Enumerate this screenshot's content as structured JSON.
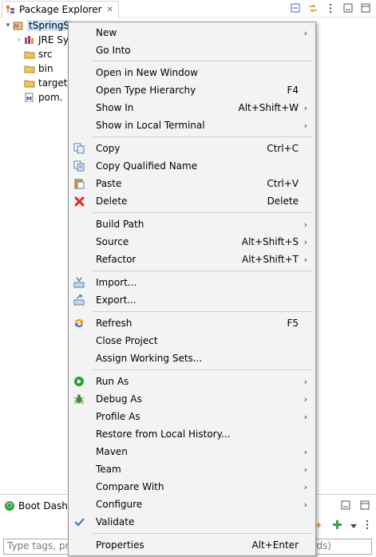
{
  "view": {
    "title": "Package Explorer",
    "close_glyph": "✕"
  },
  "tree": [
    {
      "label": "tSpringS",
      "expanded": true,
      "icon": "maven-project-icon"
    },
    {
      "label": "JRE Sy",
      "expanded": false,
      "icon": "library-icon"
    },
    {
      "label": "src",
      "icon": "folder-icon"
    },
    {
      "label": "bin",
      "icon": "folder-icon"
    },
    {
      "label": "target",
      "icon": "folder-icon"
    },
    {
      "label": "pom.",
      "icon": "maven-file-icon"
    }
  ],
  "menu": {
    "items": [
      {
        "label": "New",
        "accel": "",
        "submenu": true,
        "icon": ""
      },
      {
        "label": "Go Into",
        "accel": "",
        "submenu": false,
        "icon": ""
      },
      {
        "label": "Open in New Window",
        "accel": "",
        "submenu": false,
        "icon": ""
      },
      {
        "label": "Open Type Hierarchy",
        "accel": "F4",
        "submenu": false,
        "icon": ""
      },
      {
        "label": "Show In",
        "accel": "Alt+Shift+W",
        "submenu": true,
        "icon": ""
      },
      {
        "label": "Show in Local Terminal",
        "accel": "",
        "submenu": true,
        "icon": ""
      },
      {
        "label": "Copy",
        "accel": "Ctrl+C",
        "submenu": false,
        "icon": "copy-icon"
      },
      {
        "label": "Copy Qualified Name",
        "accel": "",
        "submenu": false,
        "icon": "copy-qualified-name-icon"
      },
      {
        "label": "Paste",
        "accel": "Ctrl+V",
        "submenu": false,
        "icon": "paste-icon"
      },
      {
        "label": "Delete",
        "accel": "Delete",
        "submenu": false,
        "icon": "delete-icon"
      },
      {
        "label": "Build Path",
        "accel": "",
        "submenu": true,
        "icon": ""
      },
      {
        "label": "Source",
        "accel": "Alt+Shift+S",
        "submenu": true,
        "icon": ""
      },
      {
        "label": "Refactor",
        "accel": "Alt+Shift+T",
        "submenu": true,
        "icon": ""
      },
      {
        "label": "Import...",
        "accel": "",
        "submenu": false,
        "icon": "import-icon"
      },
      {
        "label": "Export...",
        "accel": "",
        "submenu": false,
        "icon": "export-icon"
      },
      {
        "label": "Refresh",
        "accel": "F5",
        "submenu": false,
        "icon": "refresh-icon"
      },
      {
        "label": "Close Project",
        "accel": "",
        "submenu": false,
        "icon": ""
      },
      {
        "label": "Assign Working Sets...",
        "accel": "",
        "submenu": false,
        "icon": ""
      },
      {
        "label": "Run As",
        "accel": "",
        "submenu": true,
        "icon": "run-icon"
      },
      {
        "label": "Debug As",
        "accel": "",
        "submenu": true,
        "icon": "debug-icon"
      },
      {
        "label": "Profile As",
        "accel": "",
        "submenu": true,
        "icon": ""
      },
      {
        "label": "Restore from Local History...",
        "accel": "",
        "submenu": false,
        "icon": ""
      },
      {
        "label": "Maven",
        "accel": "",
        "submenu": true,
        "icon": ""
      },
      {
        "label": "Team",
        "accel": "",
        "submenu": true,
        "icon": ""
      },
      {
        "label": "Compare With",
        "accel": "",
        "submenu": true,
        "icon": ""
      },
      {
        "label": "Configure",
        "accel": "",
        "submenu": true,
        "icon": ""
      },
      {
        "label": "Validate",
        "accel": "",
        "submenu": false,
        "icon": "check-icon"
      },
      {
        "label": "Properties",
        "accel": "Alt+Enter",
        "submenu": false,
        "icon": ""
      }
    ]
  },
  "boot_dashboard": {
    "title": "Boot Dashb",
    "filter_placeholder": "Type tags, pro",
    "filter_tail": "rds)"
  },
  "colors": {
    "menu_bg": "#f3f3f3",
    "selection": "#cce3f8",
    "run_green": "#2e9b3c",
    "delete_red": "#d9302a"
  }
}
